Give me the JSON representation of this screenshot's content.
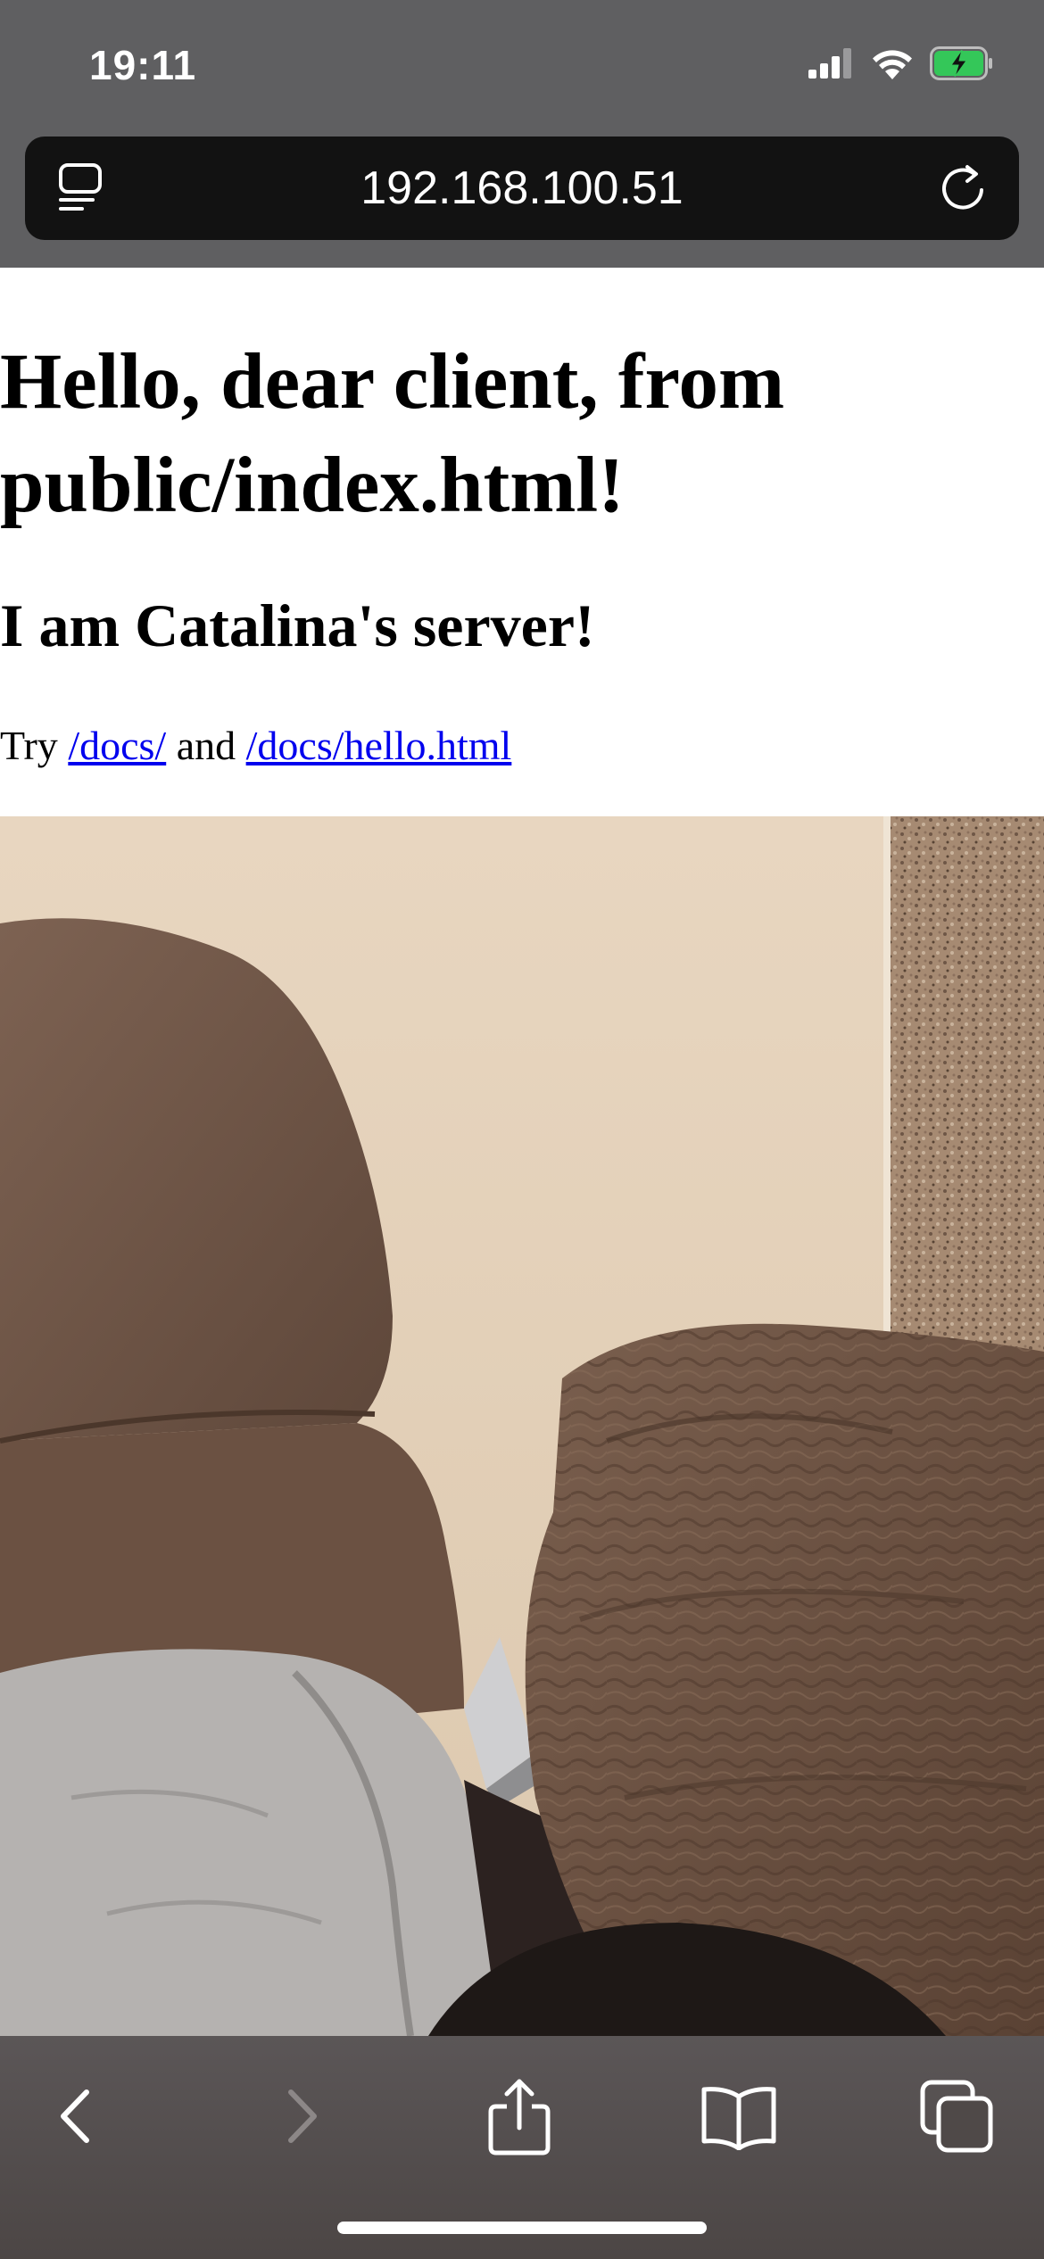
{
  "status_bar": {
    "time": "19:11",
    "icons": [
      "cellular-signal-icon",
      "wifi-icon",
      "battery-charging-icon"
    ]
  },
  "browser": {
    "url": "192.168.100.51",
    "reader_icon": "reader-mode-icon",
    "reload_icon": "reload-icon"
  },
  "page": {
    "heading": "Hello, dear client, from public/index.html!",
    "subheading": "I am Catalina's server!",
    "paragraph_prefix": "Try ",
    "link1": "/docs/",
    "paragraph_middle": " and ",
    "link2": "/docs/hello.html",
    "link_color": "#0000ee"
  },
  "toolbar": {
    "buttons": [
      "back-icon",
      "forward-icon",
      "share-icon",
      "bookmarks-icon",
      "tabs-icon"
    ]
  }
}
